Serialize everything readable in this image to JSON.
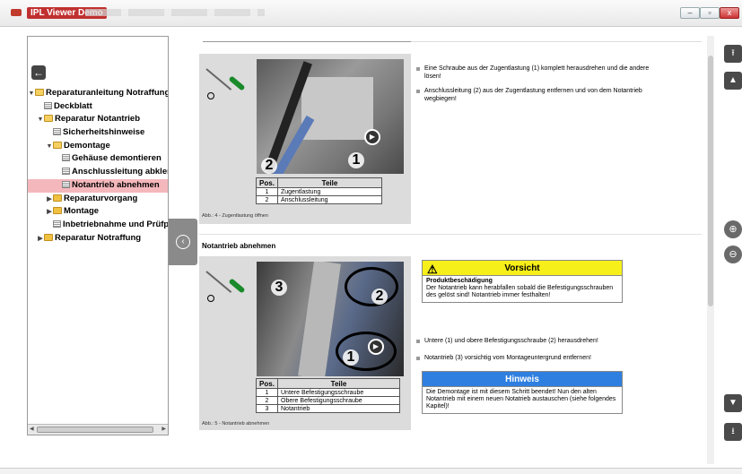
{
  "window": {
    "title": "IPL Viewer Demo",
    "minimize": "–",
    "maximize": "▫",
    "close": "x"
  },
  "nav": {
    "back_icon": "back-arrow-icon",
    "collapse_icon": "chevron-left-icon"
  },
  "tree": [
    {
      "label": "Reparaturanleitung Notraffung",
      "level": 0,
      "type": "folder",
      "expanded": true
    },
    {
      "label": "Deckblatt",
      "level": 1,
      "type": "page"
    },
    {
      "label": "Reparatur Notantrieb",
      "level": 1,
      "type": "folder",
      "expanded": true
    },
    {
      "label": "Sicherheitshinweise",
      "level": 2,
      "type": "page"
    },
    {
      "label": "Demontage",
      "level": 2,
      "type": "folder",
      "expanded": true
    },
    {
      "label": "Gehäuse demontieren",
      "level": 3,
      "type": "page"
    },
    {
      "label": "Anschlussleitung abklemmen",
      "level": 3,
      "type": "page"
    },
    {
      "label": "Notantrieb abnehmen",
      "level": 3,
      "type": "page",
      "selected": true
    },
    {
      "label": "Reparaturvorgang",
      "level": 2,
      "type": "folder",
      "expanded": false
    },
    {
      "label": "Montage",
      "level": 2,
      "type": "folder",
      "expanded": false
    },
    {
      "label": "Inbetriebnahme und Prüfprotokoll",
      "level": 2,
      "type": "page"
    },
    {
      "label": "Reparatur Notraffung",
      "level": 1,
      "type": "folder",
      "expanded": false
    }
  ],
  "figure1": {
    "callouts": [
      "1",
      "2"
    ],
    "table_header": {
      "pos": "Pos.",
      "parts": "Teile"
    },
    "rows": [
      {
        "pos": "1",
        "part": "Zugentlastung"
      },
      {
        "pos": "2",
        "part": "Anschlussleitung"
      }
    ],
    "caption": "Abb.: 4 - Zugentlastung öffnen",
    "steps": [
      "Eine Schraube aus der Zugentlastung (1) komplett herausdrehen und die andere lösen!",
      "Anschlussleitung (2) aus der Zugentlastung entfernen und von dem Notantrieb wegbiegen!"
    ]
  },
  "section2": {
    "title": "Notantrieb abnehmen",
    "callouts": [
      "3",
      "2",
      "1"
    ],
    "table_header": {
      "pos": "Pos.",
      "parts": "Teile"
    },
    "rows": [
      {
        "pos": "1",
        "part": "Untere Befestigungsschraube"
      },
      {
        "pos": "2",
        "part": "Obere Befestigungsschraube"
      },
      {
        "pos": "3",
        "part": "Notantrieb"
      }
    ],
    "caption": "Abb.: 5 - Notantrieb abnehmen",
    "warning": {
      "title": "Vorsicht",
      "icon": "warning-triangle-icon",
      "bold": "Produktbeschädigung",
      "text": "Der Notantrieb kann herabfallen sobald die Befestigungsschrauben des gelöst sind! Notantrieb immer festhalten!"
    },
    "steps": [
      "Untere (1) und obere Befestigungsschraube (2) herausdrehen!",
      "Notantrieb (3) vorsichtig vom Montageuntergrund entfernen!"
    ],
    "hint": {
      "title": "Hinweis",
      "text": "Die Demontage ist mit diesem Schritt beendet! Nun den alten Notantrieb mit einem neuen Notatrieb austauschen (siehe folgendes Kapitel)!"
    }
  },
  "toolbar": {
    "first_page": "⭱",
    "prev_page": "▲",
    "zoom_in": "⊕",
    "zoom_out": "⊖",
    "next_page": "▼",
    "last_page": "⭳"
  }
}
